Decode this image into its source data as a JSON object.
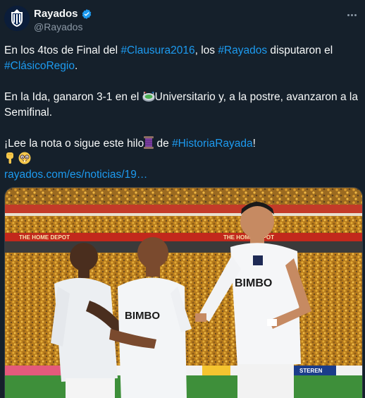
{
  "tweet": {
    "display_name": "Rayados",
    "handle": "@Rayados",
    "line1": {
      "pre": "En los 4tos de Final del ",
      "ht1": "#Clausura2016",
      "mid": ", los ",
      "ht2": "#Rayados",
      "post": " disputaron el ",
      "ht3": "#ClásicoRegio",
      "end": "."
    },
    "line2": {
      "pre": "En la Ida, ganaron 3-1 en el ",
      "post": "Universitario y, a la postre, avanzaron a la Semifinal."
    },
    "line3": {
      "pre": "¡Lee la nota o sigue este hilo",
      "mid": " de ",
      "ht": "#HistoriaRayada",
      "end": "!"
    },
    "link": "rayados.com/es/noticias/19…"
  },
  "media": {
    "jersey_sponsor": "BIMBO",
    "banner_left": "THE HOME DEPOT",
    "banner_right": "STEREN"
  },
  "icons": {
    "verified": "verified-badge-icon",
    "more": "more-options-icon",
    "stadium": "stadium-emoji",
    "thread": "thread-spool-emoji",
    "point_down": "point-down-emoji",
    "nerd": "nerd-face-emoji"
  },
  "colors": {
    "background": "#15202b",
    "text": "#f7f9f9",
    "muted": "#8b98a5",
    "link": "#1d9bf0",
    "verified": "#1d9bf0"
  }
}
